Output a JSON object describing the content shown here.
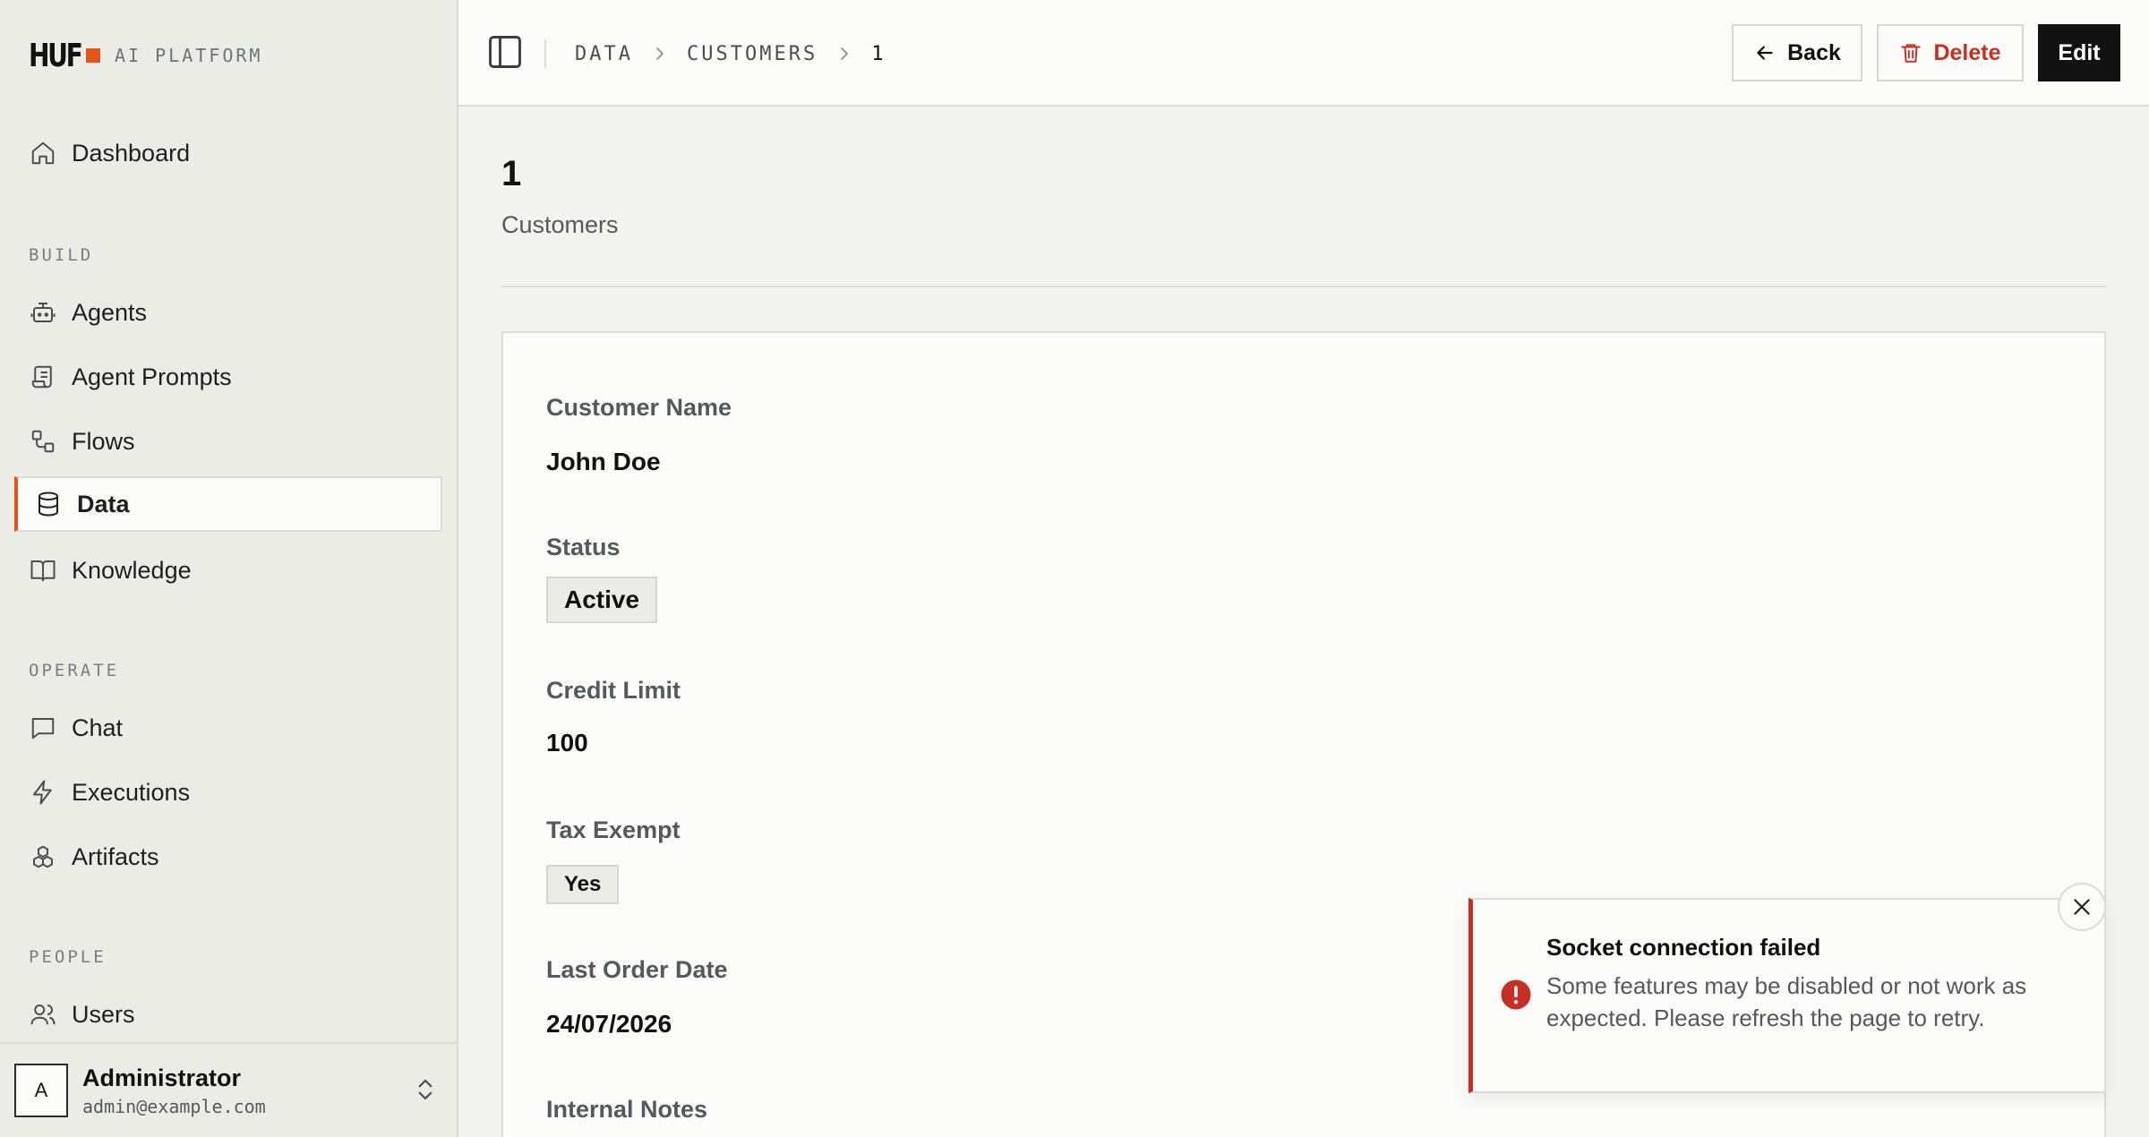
{
  "brand": {
    "logo": "HUF",
    "name": "AI PLATFORM",
    "accent": "#e2561c"
  },
  "sidebar": {
    "dashboard": "Dashboard",
    "sections": {
      "build": "BUILD",
      "operate": "OPERATE",
      "people": "PEOPLE"
    },
    "items": {
      "agents": "Agents",
      "agent_prompts": "Agent Prompts",
      "flows": "Flows",
      "data": "Data",
      "knowledge": "Knowledge",
      "chat": "Chat",
      "executions": "Executions",
      "artifacts": "Artifacts",
      "users": "Users"
    },
    "active": "data",
    "user": {
      "initial": "A",
      "name": "Administrator",
      "email": "admin@example.com"
    }
  },
  "breadcrumb": [
    "DATA",
    "CUSTOMERS",
    "1"
  ],
  "toolbar": {
    "back": "Back",
    "delete": "Delete",
    "edit": "Edit"
  },
  "record": {
    "title": "1",
    "subtitle": "Customers",
    "fields": {
      "customer_name": {
        "label": "Customer Name",
        "value": "John Doe"
      },
      "status": {
        "label": "Status",
        "value": "Active"
      },
      "credit_limit": {
        "label": "Credit Limit",
        "value": "100"
      },
      "tax_exempt": {
        "label": "Tax Exempt",
        "value": "Yes"
      },
      "last_order_date": {
        "label": "Last Order Date",
        "value": "24/07/2026"
      },
      "internal_notes": {
        "label": "Internal Notes"
      }
    }
  },
  "toast": {
    "title": "Socket connection failed",
    "message": "Some features may be disabled or not work as expected. Please refresh the page to retry.",
    "color": "#c62f22"
  }
}
